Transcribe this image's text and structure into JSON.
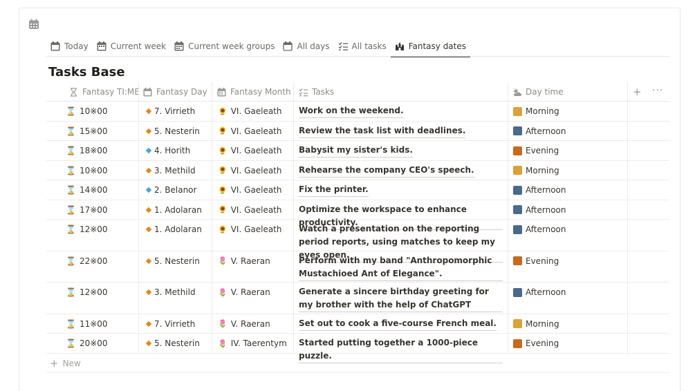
{
  "database": {
    "icon": "calendar-icon",
    "title": "Tasks Base"
  },
  "tabs": [
    {
      "label": "Today",
      "icon": "calendar-icon",
      "active": false
    },
    {
      "label": "Current week",
      "icon": "calendar-icon",
      "active": false
    },
    {
      "label": "Current week groups",
      "icon": "calendar-icon",
      "active": false
    },
    {
      "label": "All days",
      "icon": "calendar-outline-icon",
      "active": false
    },
    {
      "label": "All tasks",
      "icon": "checklist-icon",
      "active": false
    },
    {
      "label": "Fantasy dates",
      "icon": "castle-icon",
      "active": true
    }
  ],
  "columns": [
    {
      "label": "Fantasy TI:ME",
      "icon": "hourglass-icon"
    },
    {
      "label": "Fantasy Day",
      "icon": "calendar-icon"
    },
    {
      "label": "Fantasy Month",
      "icon": "calendar-grid-icon"
    },
    {
      "label": "Tasks",
      "icon": "checklist-icon"
    },
    {
      "label": "Day time",
      "icon": "weather-icon"
    }
  ],
  "header_actions": {
    "add": "+",
    "more": "···"
  },
  "rows": [
    {
      "time": "10※00",
      "day": "7. Virrieth",
      "day_color": "#e08a1e",
      "month": "VI. Gaeleath",
      "month_icon": "sunflower-icon",
      "task": "Work on the weekend.",
      "daytime": "Morning",
      "daytime_color": "#d9a23a"
    },
    {
      "time": "15※00",
      "day": "5. Nesterin",
      "day_color": "#e08a1e",
      "month": "VI. Gaeleath",
      "month_icon": "sunflower-icon",
      "task": "Review the task list with deadlines.",
      "daytime": "Afternoon",
      "daytime_color": "#4a6a8a"
    },
    {
      "time": "18※00",
      "day": "4. Horith",
      "day_color": "#4ea3d9",
      "month": "VI. Gaeleath",
      "month_icon": "sunflower-icon",
      "task": "Babysit my sister's kids.",
      "daytime": "Evening",
      "daytime_color": "#c76a1e"
    },
    {
      "time": "10※00",
      "day": "3. Methild",
      "day_color": "#e08a1e",
      "month": "VI. Gaeleath",
      "month_icon": "sunflower-icon",
      "task": "Rehearse the company CEO's speech.",
      "daytime": "Morning",
      "daytime_color": "#d9a23a"
    },
    {
      "time": "14※00",
      "day": "2. Belanor",
      "day_color": "#4ea3d9",
      "month": "VI. Gaeleath",
      "month_icon": "sunflower-icon",
      "task": "Fix the printer.",
      "daytime": "Afternoon",
      "daytime_color": "#4a6a8a"
    },
    {
      "time": "17※00",
      "day": "1. Adolaran",
      "day_color": "#e08a1e",
      "month": "VI. Gaeleath",
      "month_icon": "sunflower-icon",
      "task": "Optimize the workspace to enhance productivity.",
      "daytime": "Afternoon",
      "daytime_color": "#4a6a8a"
    },
    {
      "time": "12※00",
      "day": "1. Adolaran",
      "day_color": "#e08a1e",
      "month": "VI. Gaeleath",
      "month_icon": "sunflower-icon",
      "task": "Watch a presentation on the reporting period reports, using matches to keep my eyes open.",
      "daytime": "Afternoon",
      "daytime_color": "#4a6a8a"
    },
    {
      "time": "22※00",
      "day": "5. Nesterin",
      "day_color": "#e08a1e",
      "month": "V. Raeran",
      "month_icon": "tulip-icon",
      "task": "Perform with my band \"Anthropomorphic Mustachioed Ant of Elegance\".",
      "daytime": "Evening",
      "daytime_color": "#c76a1e"
    },
    {
      "time": "12※00",
      "day": "3. Methild",
      "day_color": "#e08a1e",
      "month": "V. Raeran",
      "month_icon": "tulip-icon",
      "task": "Generate a sincere birthday greeting for my brother with the help of ChatGPT",
      "daytime": "Afternoon",
      "daytime_color": "#4a6a8a"
    },
    {
      "time": "11※00",
      "day": "7. Virrieth",
      "day_color": "#e08a1e",
      "month": "V. Raeran",
      "month_icon": "tulip-icon",
      "task": "Set out to cook a five-course French meal.",
      "daytime": "Morning",
      "daytime_color": "#d9a23a"
    },
    {
      "time": "20※00",
      "day": "5. Nesterin",
      "day_color": "#e08a1e",
      "month": "IV. Taerentym",
      "month_icon": "tulip-icon",
      "task": "Started putting together a 1000-piece puzzle.",
      "daytime": "Evening",
      "daytime_color": "#c76a1e"
    }
  ],
  "new_row": {
    "label": "New"
  }
}
